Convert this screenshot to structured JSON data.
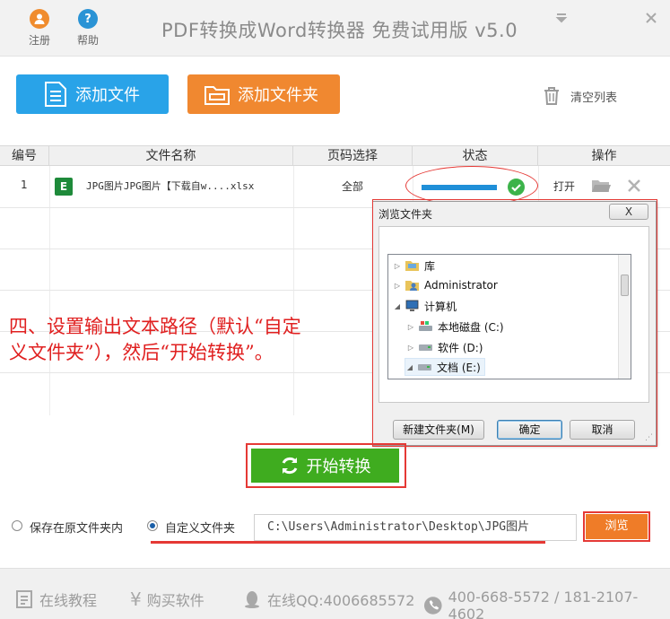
{
  "titlebar": {
    "register_label": "注册",
    "help_label": "帮助",
    "app_title": "PDF转换成Word转换器 免费试用版 v5.0",
    "colors": {
      "register": "#f08c2e",
      "help": "#2a93d5"
    }
  },
  "toolbar": {
    "add_file_label": "添加文件",
    "add_folder_label": "添加文件夹",
    "clear_list_label": "清空列表",
    "colors": {
      "add_file": "#29a3e8",
      "add_folder": "#f08830"
    }
  },
  "table": {
    "columns": [
      "编号",
      "文件名称",
      "页码选择",
      "状态",
      "操作"
    ],
    "rows": [
      {
        "index": "1",
        "file_icon": "excel-file-icon",
        "file_name": "JPG图片JPG图片【下载自w....xlsx",
        "pages": "全部",
        "progress": 1.0,
        "status_icon": "check-icon",
        "open_label": "打开"
      }
    ]
  },
  "instruction": {
    "line1": "四、设置输出文本路径（默认“自定",
    "line2": "义文件夹”），然后“开始转换”。"
  },
  "dialog": {
    "title": "浏览文件夹",
    "close_label": "X",
    "tree": [
      {
        "label": "库",
        "arrow": "▷",
        "icon": "library-icon"
      },
      {
        "label": "Administrator",
        "arrow": "▷",
        "icon": "user-folder-icon"
      },
      {
        "label": "计算机",
        "arrow": "◢",
        "icon": "computer-icon"
      },
      {
        "label": "本地磁盘 (C:)",
        "arrow": "▷",
        "icon": "windows-drive-icon"
      },
      {
        "label": "软件 (D:)",
        "arrow": "▷",
        "icon": "drive-icon"
      },
      {
        "label": "文档 (E:)",
        "arrow": "◢",
        "icon": "drive-icon"
      }
    ],
    "new_folder_label": "新建文件夹(M)",
    "ok_label": "确定",
    "cancel_label": "取消"
  },
  "convert": {
    "start_label": "开始转换"
  },
  "output": {
    "keep_original_label": "保存在原文件夹内",
    "custom_folder_label": "自定义文件夹",
    "custom_selected": true,
    "path": "C:\\Users\\Administrator\\Desktop\\JPG图片",
    "browse_label": "浏览"
  },
  "footer": {
    "tutorial_label": "在线教程",
    "buy_label": "购买软件",
    "qq_label": "在线QQ:4006685572",
    "phone_label": "400-668-5572 / 181-2107-4602"
  },
  "accent": {
    "start_green": "#3fac1f",
    "annotation_red": "#e53935",
    "browse_orange": "#ef7c28"
  }
}
